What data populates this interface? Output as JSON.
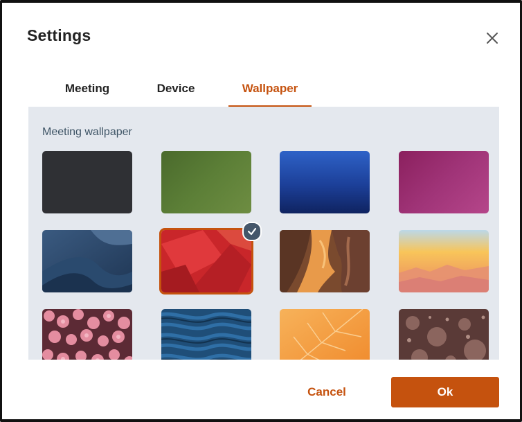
{
  "dialog": {
    "title": "Settings",
    "close_icon": "close-icon"
  },
  "tabs": [
    {
      "label": "Meeting",
      "active": false
    },
    {
      "label": "Device",
      "active": false
    },
    {
      "label": "Wallpaper",
      "active": true
    }
  ],
  "wallpaper": {
    "section_label": "Meeting wallpaper",
    "selected_index": 5,
    "tiles": [
      {
        "name": "dark-solid",
        "selected": false
      },
      {
        "name": "green",
        "selected": false
      },
      {
        "name": "blue",
        "selected": false
      },
      {
        "name": "magenta",
        "selected": false
      },
      {
        "name": "blue-dunes",
        "selected": false
      },
      {
        "name": "red-abstract",
        "selected": true
      },
      {
        "name": "canyon",
        "selected": false
      },
      {
        "name": "sunset-mountains",
        "selected": false
      },
      {
        "name": "pink-flowers",
        "selected": false
      },
      {
        "name": "blue-sand-ripples",
        "selected": false
      },
      {
        "name": "orange-leaf",
        "selected": false
      },
      {
        "name": "bokeh-brown",
        "selected": false
      }
    ]
  },
  "footer": {
    "cancel_label": "Cancel",
    "ok_label": "Ok"
  },
  "colors": {
    "accent": "#c5520e",
    "panel_bg": "#e4e8ee",
    "check_badge": "#44566a"
  }
}
